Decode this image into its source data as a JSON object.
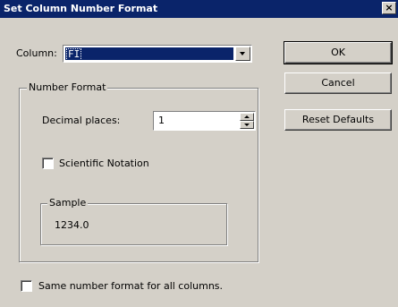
{
  "dialog": {
    "title": "Set Column Number Format",
    "close_glyph": "×"
  },
  "column": {
    "label": "Column:",
    "selected": "FI"
  },
  "number_format": {
    "group_label": "Number Format",
    "decimal_label": "Decimal places:",
    "decimal_value": "1",
    "scientific_label": "Scientific Notation",
    "scientific_checked": false,
    "sample_group_label": "Sample",
    "sample_value": "1234.0"
  },
  "same_format": {
    "label": "Same number format for all columns.",
    "checked": false
  },
  "buttons": {
    "ok": "OK",
    "cancel": "Cancel",
    "reset": "Reset Defaults"
  },
  "colors": {
    "title_bar": "#0a246a",
    "dialog_bg": "#d4d0c8",
    "selection": "#0a246a"
  },
  "icons": {
    "close": "close-icon",
    "dropdown": "chevron-down-icon",
    "spin_up": "spin-up-icon",
    "spin_down": "spin-down-icon"
  }
}
